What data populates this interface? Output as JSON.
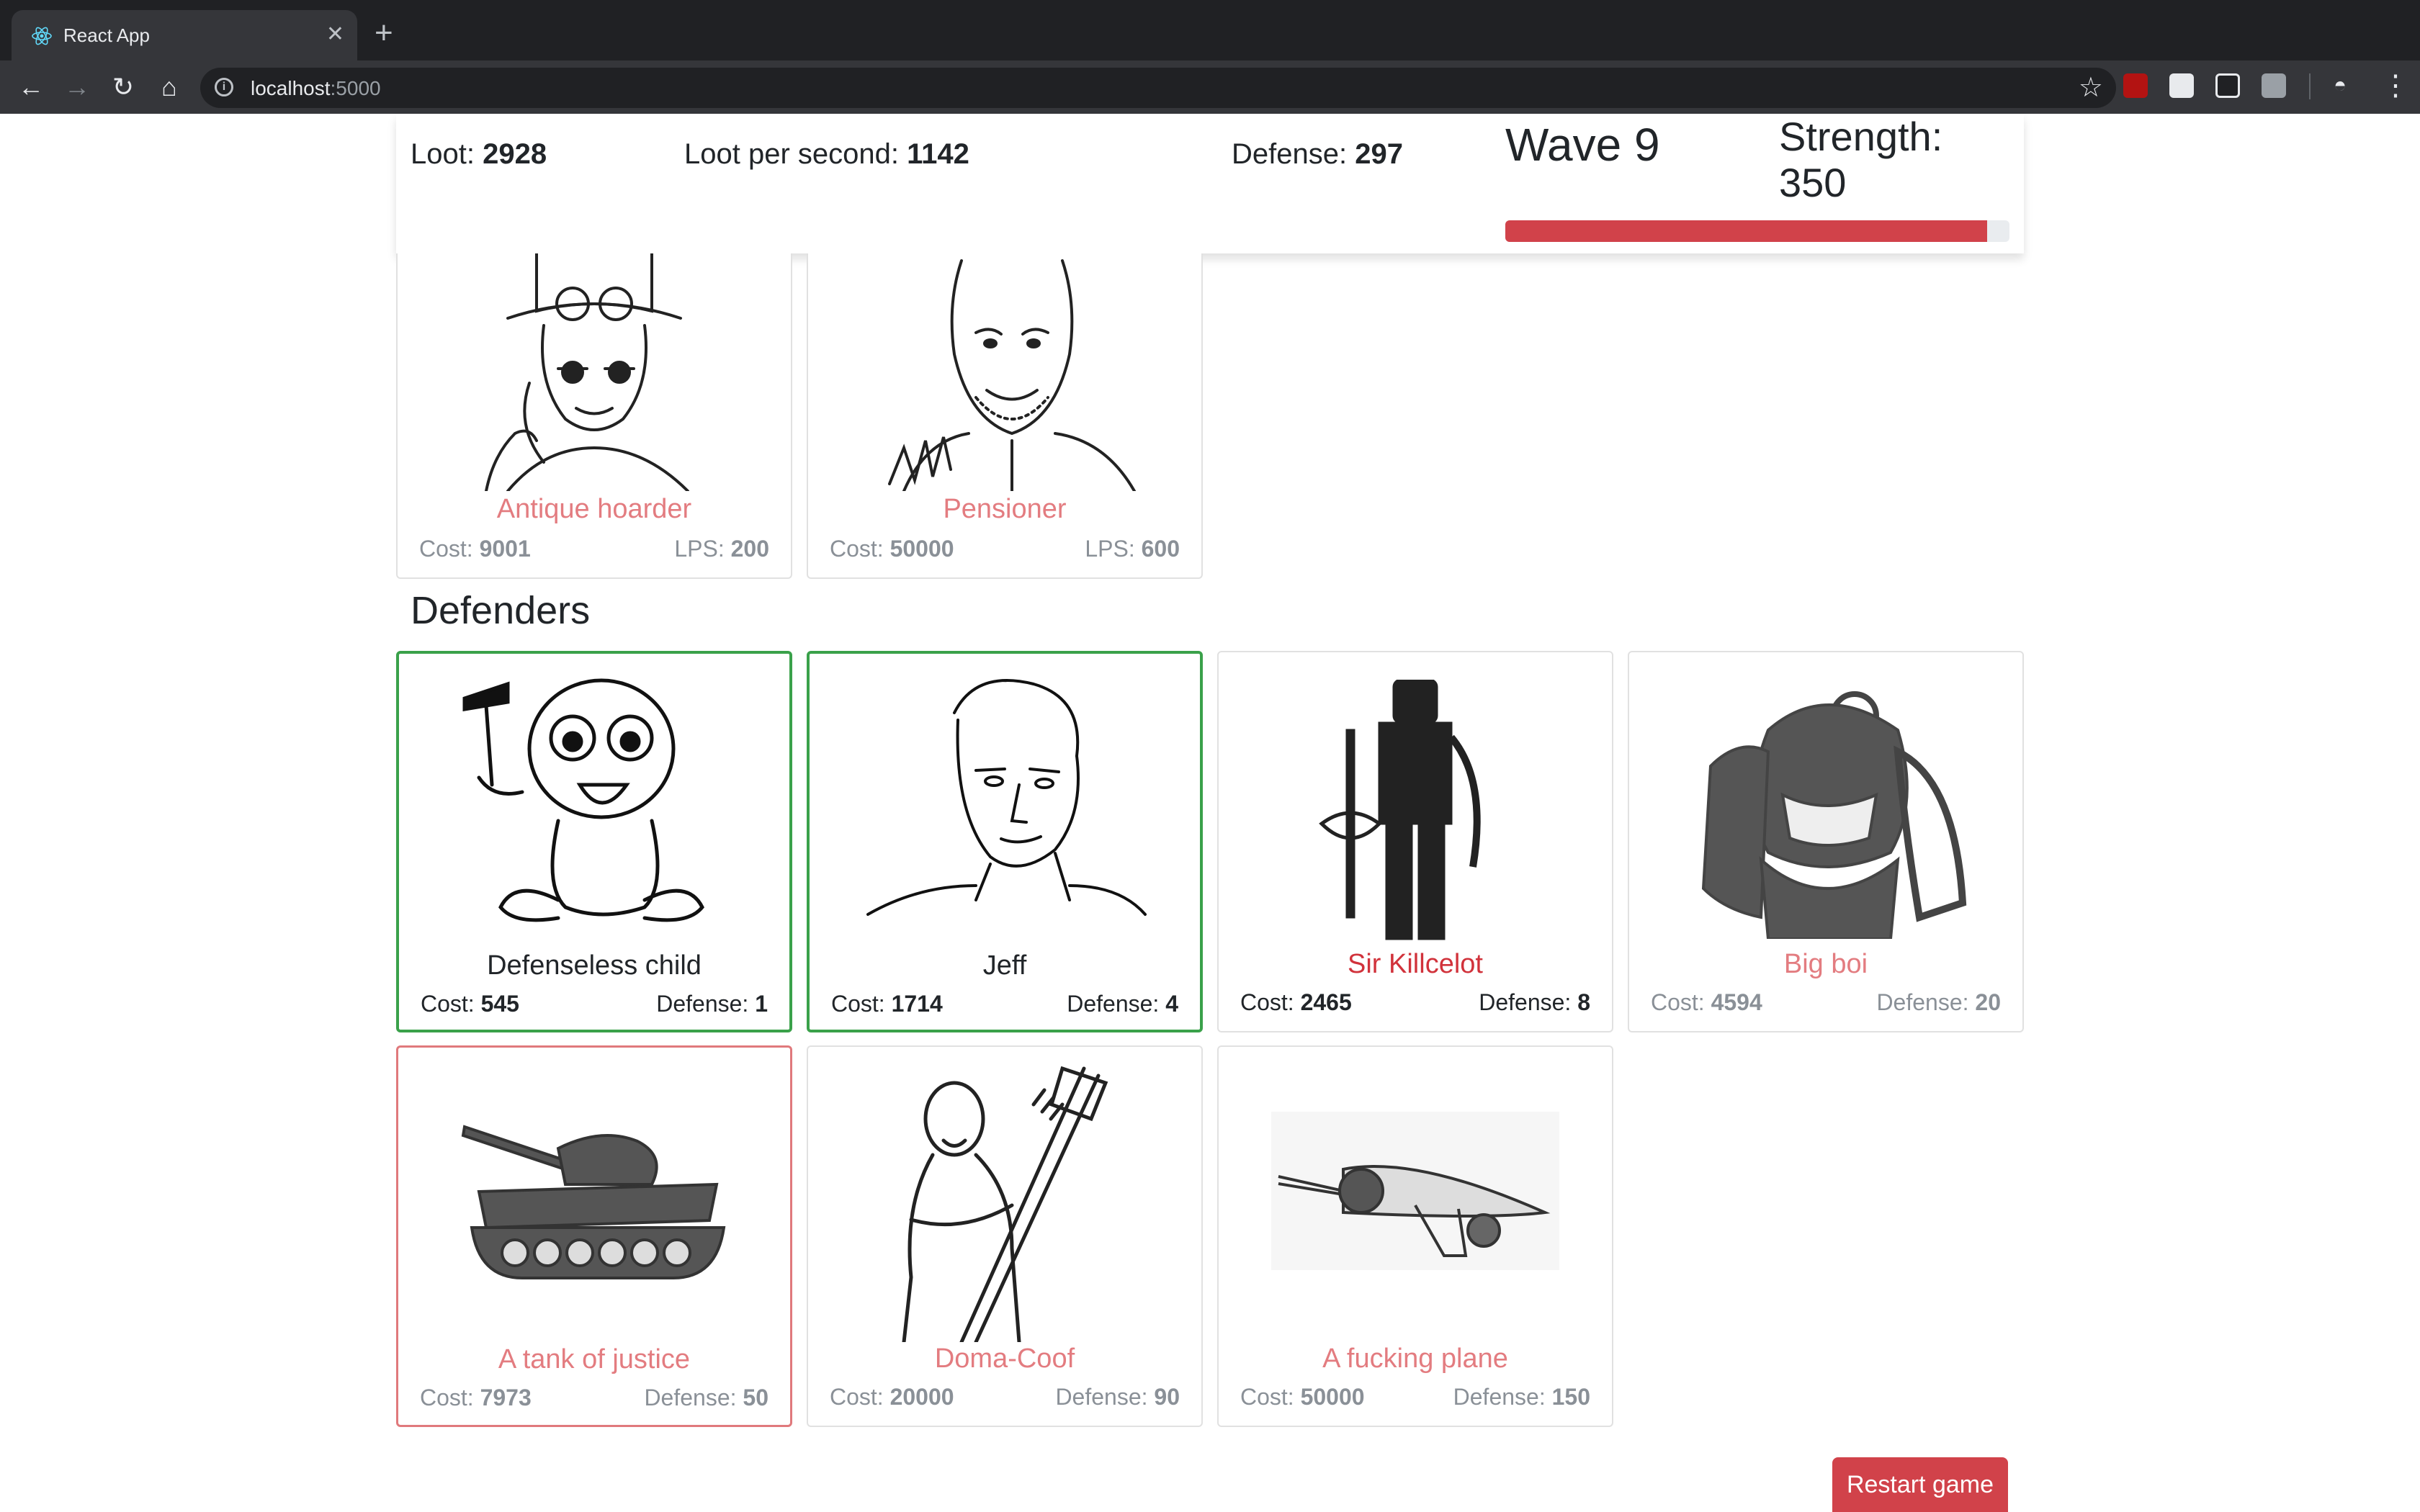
{
  "browser": {
    "tab_title": "React App",
    "url_host": "localhost",
    "url_port": ":5000"
  },
  "header": {
    "loot_label": "Loot:",
    "loot_value": "2928",
    "lps_label": "Loot per second:",
    "lps_value": "1142",
    "defense_label": "Defense:",
    "defense_value": "297",
    "wave": "Wave 9",
    "strength_label": "Strength:",
    "strength_value": "350",
    "strength_progress": 0.955
  },
  "looters": [
    {
      "name": "Antique hoarder",
      "cost_label": "Cost:",
      "cost": "9001",
      "stat_label": "LPS:",
      "stat": "200",
      "icon": "steampunk-man-icon"
    },
    {
      "name": "Pensioner",
      "cost_label": "Cost:",
      "cost": "50000",
      "stat_label": "LPS:",
      "stat": "600",
      "icon": "old-man-icon"
    }
  ],
  "defenders_title": "Defenders",
  "defenders": [
    {
      "name": "Defenseless child",
      "cost_label": "Cost:",
      "cost": "545",
      "stat_label": "Defense:",
      "stat": "1",
      "icon": "baby-with-hammer-icon"
    },
    {
      "name": "Jeff",
      "cost_label": "Cost:",
      "cost": "1714",
      "stat_label": "Defense:",
      "stat": "4",
      "icon": "man-face-icon"
    },
    {
      "name": "Sir Killcelot",
      "cost_label": "Cost:",
      "cost": "2465",
      "stat_label": "Defense:",
      "stat": "8",
      "icon": "knight-icon"
    },
    {
      "name": "Big boi",
      "cost_label": "Cost:",
      "cost": "4594",
      "stat_label": "Defense:",
      "stat": "20",
      "icon": "orc-warrior-icon"
    },
    {
      "name": "A tank of justice",
      "cost_label": "Cost:",
      "cost": "7973",
      "stat_label": "Defense:",
      "stat": "50",
      "icon": "tank-icon"
    },
    {
      "name": "Doma-Coof",
      "cost_label": "Cost:",
      "cost": "20000",
      "stat_label": "Defense:",
      "stat": "90",
      "icon": "guitar-warrior-icon"
    },
    {
      "name": "A fucking plane",
      "cost_label": "Cost:",
      "cost": "50000",
      "stat_label": "Defense:",
      "stat": "150",
      "icon": "plane-icon"
    }
  ],
  "restart_label": "Restart game",
  "colors": {
    "accent_red": "#d1424a",
    "affordable_green": "#3aa14a",
    "unaffordable_red": "#e0797c"
  }
}
